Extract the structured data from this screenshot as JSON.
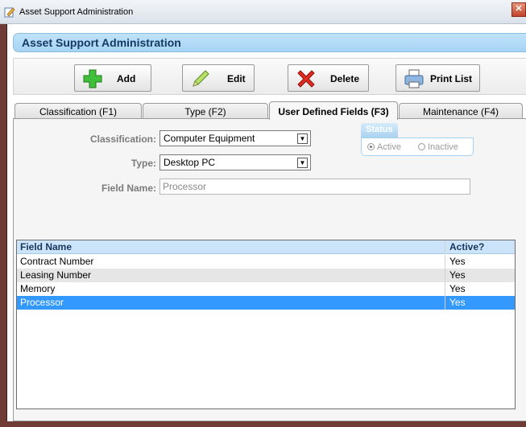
{
  "window": {
    "title": "Asset Support Administration",
    "close_label": "✕"
  },
  "header": {
    "title": "Asset Support Administration"
  },
  "toolbar": {
    "add_label": "Add",
    "edit_label": "Edit",
    "delete_label": "Delete",
    "print_label": "Print List"
  },
  "tabs": [
    {
      "label": "Classification (F1)"
    },
    {
      "label": "Type (F2)"
    },
    {
      "label": "User Defined Fields (F3)"
    },
    {
      "label": "Maintenance (F4)"
    }
  ],
  "form": {
    "classification_label": "Classification:",
    "classification_value": "Computer Equipment",
    "type_label": "Type:",
    "type_value": "Desktop PC",
    "field_name_label": "Field Name:",
    "field_name_value": "Processor",
    "status_label": "Status",
    "active_label": "Active",
    "inactive_label": "Inactive",
    "status_selected": "Active"
  },
  "grid": {
    "columns": [
      "Field Name",
      "Active?"
    ],
    "rows": [
      {
        "field": "Contract Number",
        "active": "Yes"
      },
      {
        "field": "Leasing Number",
        "active": "Yes"
      },
      {
        "field": "Memory",
        "active": "Yes"
      },
      {
        "field": "Processor",
        "active": "Yes",
        "selected": true
      }
    ]
  },
  "colors": {
    "accent": "#3399ff",
    "header_blue": "#a7d3f3",
    "frame": "#6f3b35"
  }
}
